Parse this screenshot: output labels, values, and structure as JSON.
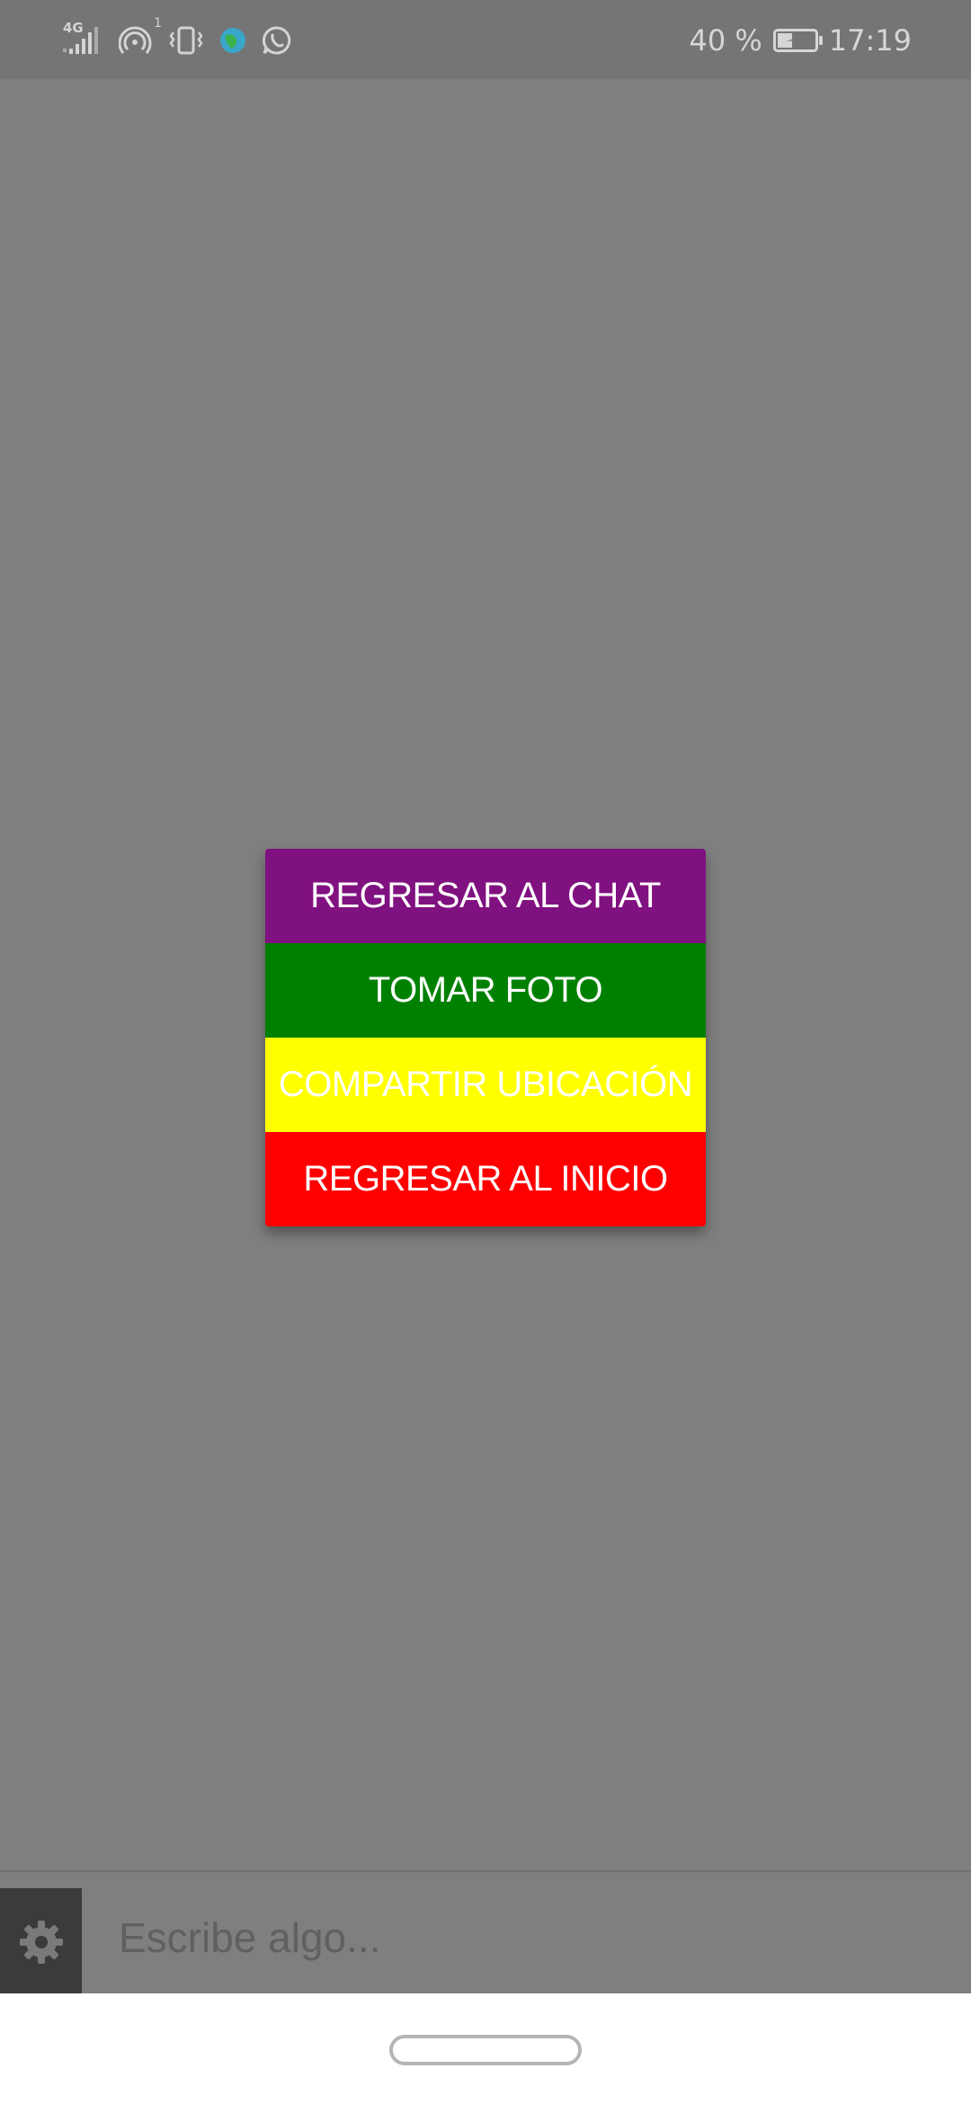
{
  "status_bar": {
    "network_label": "4G",
    "sim_index": "1",
    "battery_percent_text": "40 %",
    "battery_level": 0.4,
    "time": "17:19",
    "icons": [
      "signal-icon",
      "hotspot-icon",
      "vibrate-icon",
      "app-icon",
      "whatsapp-icon",
      "battery-charging-icon"
    ]
  },
  "menu": {
    "items": [
      {
        "label": "REGRESAR AL CHAT",
        "color": "#801180"
      },
      {
        "label": "TOMAR FOTO",
        "color": "#008000"
      },
      {
        "label": "COMPARTIR UBICACIÓN",
        "color": "#ffff00"
      },
      {
        "label": "REGRESAR AL INICIO",
        "color": "#ff0000"
      }
    ]
  },
  "composer": {
    "settings_icon": "gear-icon",
    "placeholder": "Escribe algo..."
  },
  "colors": {
    "overlay_background": "#7f7f7f",
    "status_bar_background": "#757575",
    "settings_button_background": "#3a3b3d"
  }
}
